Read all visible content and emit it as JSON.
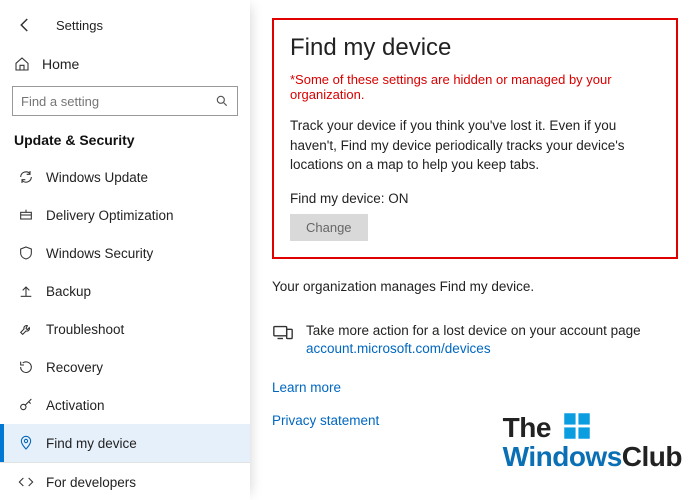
{
  "top": {
    "title": "Settings"
  },
  "home": {
    "label": "Home"
  },
  "search": {
    "placeholder": "Find a setting"
  },
  "section": {
    "label": "Update & Security"
  },
  "nav": {
    "items": [
      {
        "label": "Windows Update"
      },
      {
        "label": "Delivery Optimization"
      },
      {
        "label": "Windows Security"
      },
      {
        "label": "Backup"
      },
      {
        "label": "Troubleshoot"
      },
      {
        "label": "Recovery"
      },
      {
        "label": "Activation"
      },
      {
        "label": "Find my device"
      },
      {
        "label": "For developers"
      }
    ]
  },
  "page": {
    "title": "Find my device",
    "warning": "*Some of these settings are hidden or managed by your organization.",
    "desc": "Track your device if you think you've lost it. Even if you haven't, Find my device periodically tracks your device's locations on a map to help you keep tabs.",
    "status": "Find my device: ON",
    "change_btn": "Change",
    "org_note": "Your organization manages Find my device.",
    "more_action": "Take more action for a lost device on your account page",
    "devices_link": "account.microsoft.com/devices",
    "learn_more": "Learn more",
    "privacy": "Privacy statement"
  },
  "watermark": {
    "line1": "The",
    "line2a": "Windows",
    "line2b": "Club"
  }
}
